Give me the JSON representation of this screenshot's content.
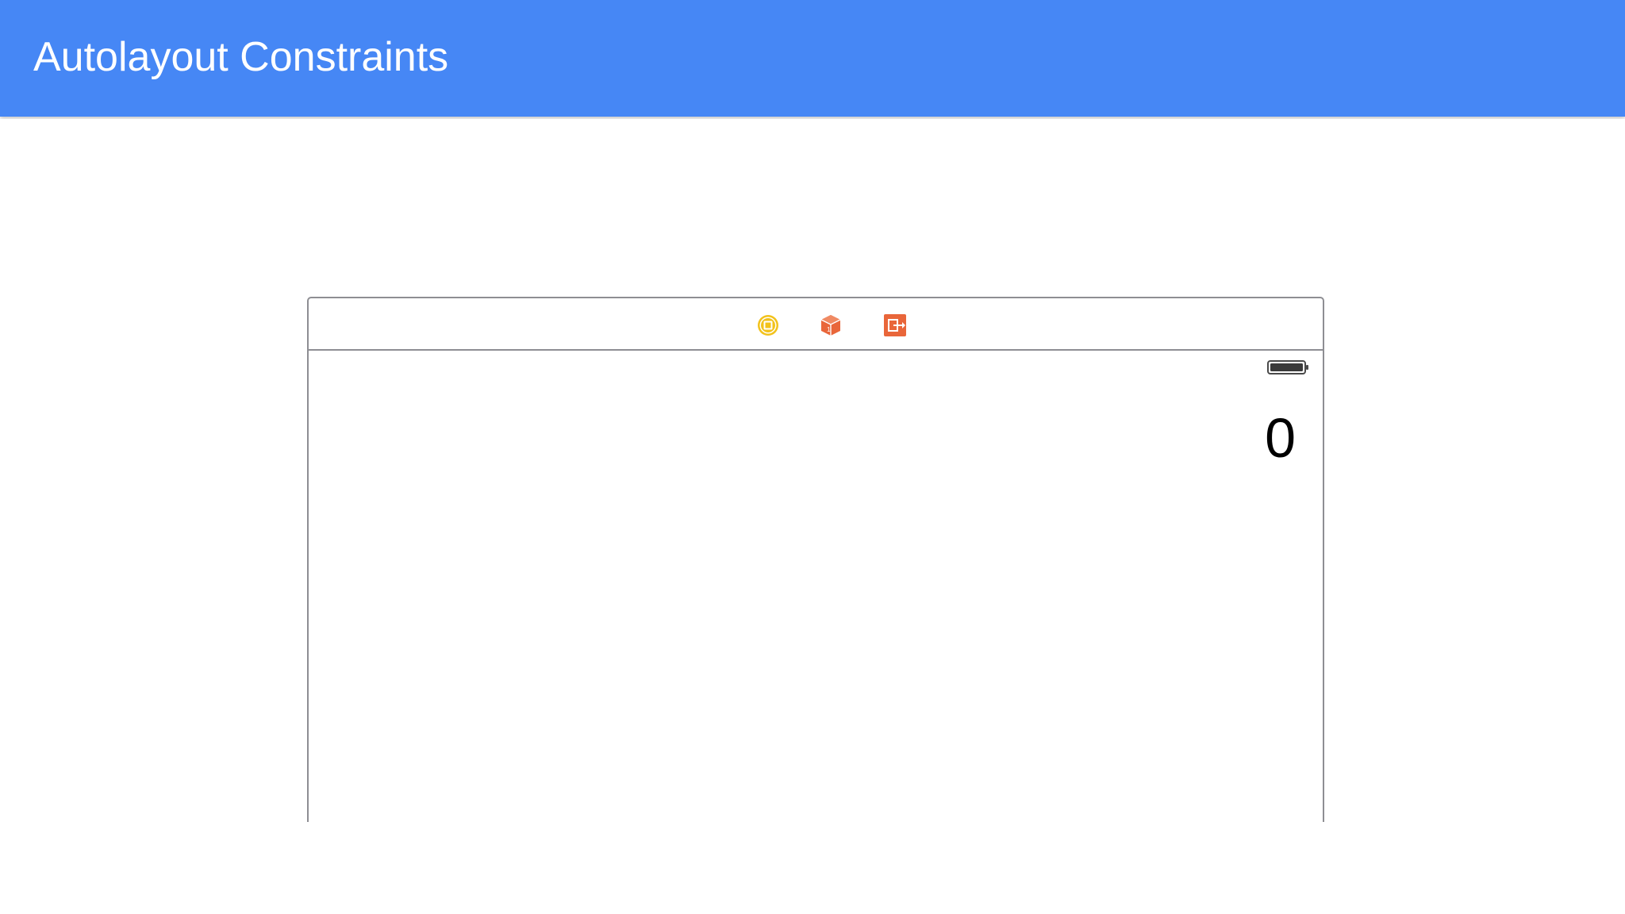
{
  "header": {
    "title": "Autolayout Constraints",
    "background_color": "#4687f5"
  },
  "storyboard": {
    "scene_dock": {
      "icons": [
        "view-controller-icon",
        "first-responder-icon",
        "exit-icon"
      ],
      "colors": {
        "view_controller": "#f2c21b",
        "first_responder": "#e9663a",
        "exit": "#e9663a"
      }
    },
    "status_bar": {
      "battery_icon": "battery-icon"
    },
    "display_label": "0"
  }
}
